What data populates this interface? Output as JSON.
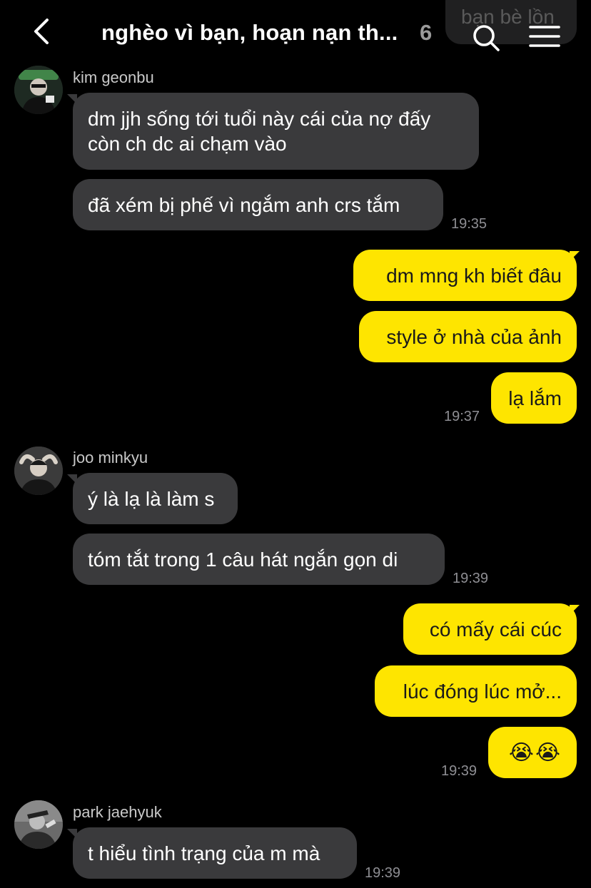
{
  "header": {
    "title": "nghèo vì bạn, hoạn nạn th...",
    "member_count": "6",
    "faded_bubble_text": "bạn bè lồn"
  },
  "colors": {
    "outgoing": "#fee500",
    "incoming": "#3a3a3c",
    "background": "#000000"
  },
  "icons": {
    "back": "chevron-left-icon",
    "search": "search-icon",
    "menu": "hamburger-menu-icon"
  },
  "messages": {
    "g1": {
      "sender": "kim geonbu",
      "m1": "dm jjh sống tới tuổi này cái của nợ đấy còn ch dc ai chạm vào",
      "m2": "đã xém bị phế vì ngắm anh crs tắm",
      "time": "19:35"
    },
    "g2": {
      "m1": "dm mng kh biết đâu",
      "m2": "style ở nhà của ảnh",
      "m3": "lạ lắm",
      "time": "19:37"
    },
    "g3": {
      "sender": "joo minkyu",
      "m1": "ý là lạ là làm s",
      "m2": "tóm tắt trong 1 câu hát ngắn gọn di",
      "time": "19:39"
    },
    "g4": {
      "m1": "có mấy cái cúc",
      "m2": "lúc đóng lúc mở...",
      "m3": "😭😭",
      "time": "19:39"
    },
    "g5": {
      "sender": "park jaehyuk",
      "m1": "t hiểu tình trạng của m mà",
      "time": "19:39"
    }
  }
}
